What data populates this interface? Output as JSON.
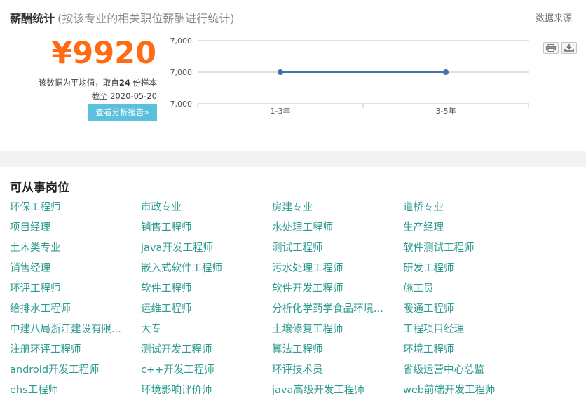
{
  "salary": {
    "title": "薪酬统计",
    "subtitle": "(按该专业的相关职位薪酬进行统计)",
    "data_source_label": "数据来源",
    "value": "¥9920",
    "note_prefix": "该数据为平均值，取自",
    "sample_count": "24",
    "note_suffix": " 份样本",
    "date_line": "截至 2020-05-20",
    "report_button": "查看分析报告»"
  },
  "chart_data": {
    "type": "line",
    "categories": [
      "1-3年",
      "3-5年"
    ],
    "series": [
      {
        "values": [
          7000,
          7000
        ]
      }
    ],
    "yticks": [
      "7,000",
      "7,000",
      "7,000"
    ],
    "grid": true,
    "color": "#4572a7"
  },
  "toolbar": {
    "print_icon": "print-icon",
    "download_icon": "download-icon"
  },
  "jobs": {
    "title": "可从事岗位",
    "columns": [
      [
        "环保工程师",
        "项目经理",
        "土木类专业",
        "销售经理",
        "环评工程师",
        "给排水工程师",
        "中建八局浙江建设有限...",
        "注册环评工程师",
        "android开发工程师",
        "ehs工程师"
      ],
      [
        "市政专业",
        "销售工程师",
        "java开发工程师",
        "嵌入式软件工程师",
        "软件工程师",
        "运维工程师",
        "大专",
        "测试开发工程师",
        "c++开发工程师",
        "环境影响评价师"
      ],
      [
        "房建专业",
        "水处理工程师",
        "测试工程师",
        "污水处理工程师",
        "软件开发工程师",
        "分析化学药学食品环境...",
        "土壤修复工程师",
        "算法工程师",
        "环评技术员",
        "java高级开发工程师"
      ],
      [
        "道桥专业",
        "生产经理",
        "软件测试工程师",
        "研发工程师",
        "施工员",
        "暖通工程师",
        "工程项目经理",
        "环境工程师",
        "省级运营中心总监",
        "web前端开发工程师"
      ]
    ]
  }
}
